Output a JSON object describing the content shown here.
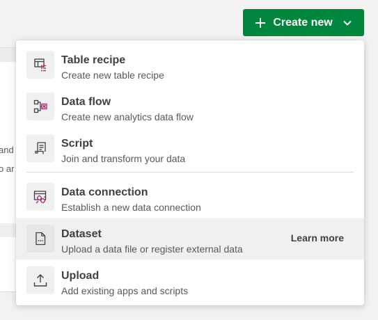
{
  "header": {
    "create_button_label": "Create new"
  },
  "background": {
    "fragment_1": "and",
    "fragment_2": "o ar"
  },
  "menu": {
    "items": [
      {
        "title": "Table recipe",
        "description": "Create new table recipe",
        "icon": "table-recipe-icon"
      },
      {
        "title": "Data flow",
        "description": "Create new analytics data flow",
        "icon": "data-flow-icon"
      },
      {
        "title": "Script",
        "description": "Join and transform your data",
        "icon": "script-icon"
      },
      {
        "title": "Data connection",
        "description": "Establish a new data connection",
        "icon": "data-connection-icon"
      },
      {
        "title": "Dataset",
        "description": "Upload a data file or register external data",
        "icon": "dataset-icon",
        "link": "Learn more"
      },
      {
        "title": "Upload",
        "description": "Add existing apps and scripts",
        "icon": "upload-icon"
      }
    ]
  },
  "colors": {
    "primary_button": "#00873d",
    "icon_accent": "#a6226f",
    "text": "#404040"
  }
}
